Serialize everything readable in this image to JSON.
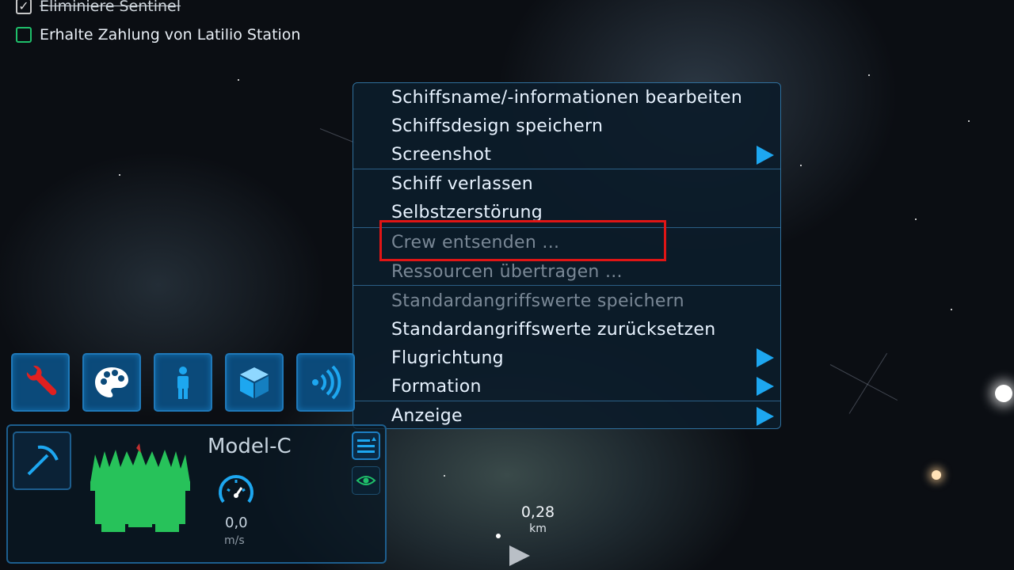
{
  "objectives": [
    {
      "label": "Eliminiere Sentinel",
      "done": true
    },
    {
      "label": "Erhalte Zahlung von Latilio Station",
      "done": false
    }
  ],
  "context_menu": {
    "items": [
      {
        "label": "Schiffsname/-informationen bearbeiten",
        "enabled": true
      },
      {
        "label": "Schiffsdesign speichern",
        "enabled": true
      },
      {
        "label": "Screenshot",
        "enabled": true,
        "submenu": true
      },
      {
        "label": "Schiff verlassen",
        "enabled": true
      },
      {
        "label": "Selbstzerstörung",
        "enabled": true
      },
      {
        "label": "Crew entsenden ...",
        "enabled": false
      },
      {
        "label": "Ressourcen übertragen ...",
        "enabled": false
      },
      {
        "label": "Standardangriffswerte speichern",
        "enabled": false
      },
      {
        "label": "Standardangriffswerte zurücksetzen",
        "enabled": true
      },
      {
        "label": "Flugrichtung",
        "enabled": true,
        "submenu": true
      },
      {
        "label": "Formation",
        "enabled": true,
        "submenu": true
      },
      {
        "label": "Anzeige",
        "enabled": true,
        "submenu": true
      }
    ],
    "highlighted_item": "Crew entsenden ..."
  },
  "toolbar": {
    "buttons": [
      {
        "icon": "wrench-icon"
      },
      {
        "icon": "palette-icon"
      },
      {
        "icon": "person-icon"
      },
      {
        "icon": "cube-icon"
      },
      {
        "icon": "signal-icon"
      }
    ]
  },
  "ship": {
    "name": "Model-C",
    "speed_value": "0,0",
    "speed_unit": "m/s",
    "tool_icon": "pickaxe-icon"
  },
  "target": {
    "distance_value": "0,28",
    "distance_unit": "km"
  },
  "colors": {
    "menu_bg": "#0c1c2a",
    "accent_blue": "#1da7f0",
    "highlight_red": "#e01515",
    "ship_green": "#27c25a",
    "wrench_red": "#e02020"
  }
}
